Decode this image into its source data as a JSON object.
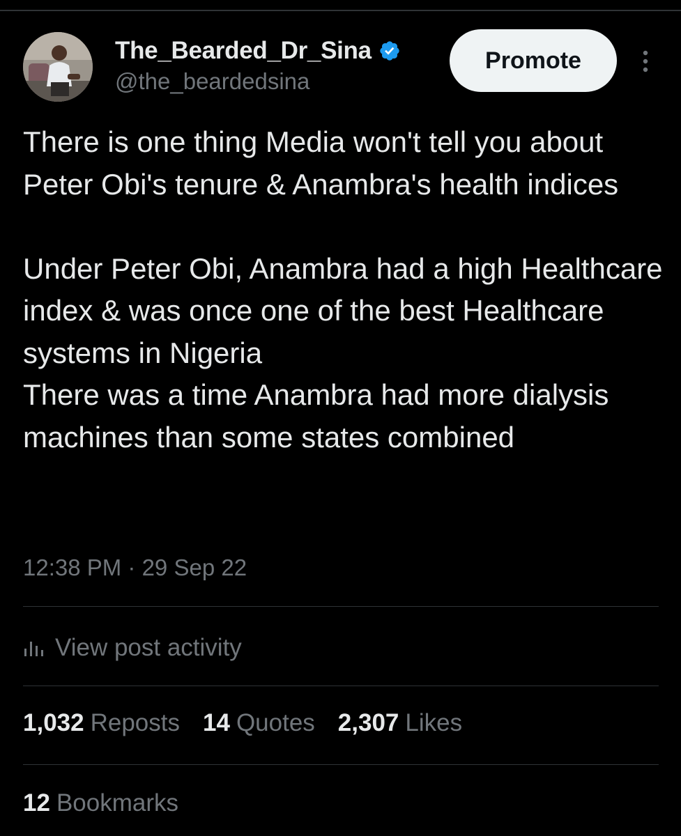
{
  "author": {
    "display_name": "The_Bearded_Dr_Sina",
    "handle": "@the_beardedsina",
    "verified": true,
    "verified_icon": "verified-badge-icon",
    "verified_color": "#1d9bf0"
  },
  "header": {
    "promote_label": "Promote",
    "more_icon": "more-vertical-icon"
  },
  "tweet": {
    "text": "There is one thing Media won't tell you about Peter Obi's tenure & Anambra's health indices\n\nUnder Peter Obi, Anambra had a high Healthcare index & was once one of the best Healthcare systems in Nigeria\nThere was a time Anambra had more dialysis machines than some states combined",
    "timestamp": "12:38 PM · 29 Sep 22"
  },
  "activity": {
    "label": "View post activity",
    "icon": "bar-chart-icon"
  },
  "stats": {
    "reposts_count": "1,032",
    "reposts_label": "Reposts",
    "quotes_count": "14",
    "quotes_label": "Quotes",
    "likes_count": "2,307",
    "likes_label": "Likes",
    "bookmarks_count": "12",
    "bookmarks_label": "Bookmarks"
  },
  "colors": {
    "background": "#000000",
    "text_primary": "#e7e9ea",
    "text_secondary": "#71767b",
    "divider": "#2f3336",
    "button_bg": "#eff3f4"
  }
}
